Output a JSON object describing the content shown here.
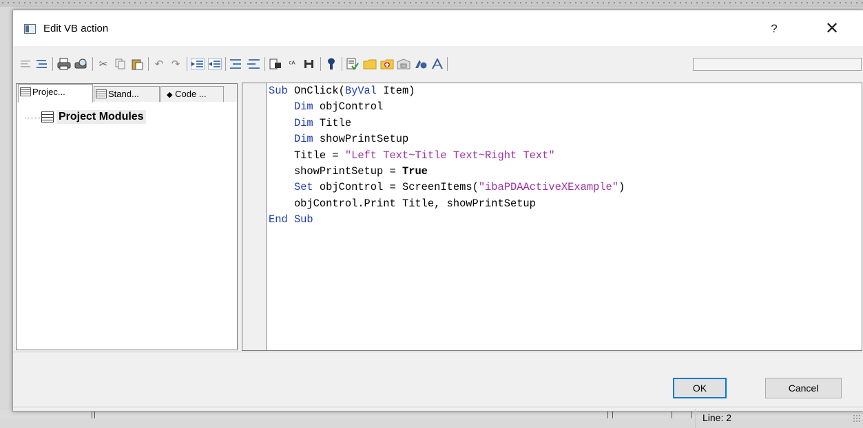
{
  "window": {
    "title": "Edit VB action",
    "help_label": "?",
    "close_label": "✕"
  },
  "toolbar": {
    "icons": [
      "align-left-icon",
      "align-lines-icon",
      "print-icon",
      "print-preview-icon",
      "cut-icon",
      "copy-icon",
      "paste-icon",
      "undo-icon",
      "redo-icon",
      "indent-icon",
      "outdent-icon",
      "comment-icon",
      "uncomment-icon",
      "find-icon",
      "replace-icon",
      "goto-icon",
      "breakpoint-icon",
      "syntax-check-icon",
      "folder-icon",
      "add-icon",
      "module-icon",
      "object-icon",
      "function-icon"
    ]
  },
  "left_panel": {
    "tabs": [
      {
        "label": "Projec..."
      },
      {
        "label": "Stand..."
      },
      {
        "label": "Code ..."
      }
    ],
    "tree": {
      "root_label": "Project Modules"
    }
  },
  "editor": {
    "lines": [
      "Sub OnClick(ByVal Item)",
      "    Dim objControl",
      "    Dim Title",
      "    Dim showPrintSetup",
      "    Title = \"Left Text~Title Text~Right Text\"",
      "    showPrintSetup = True",
      "    Set objControl = ScreenItems(\"ibaPDAActiveXExample\")",
      "    objControl.Print Title, showPrintSetup",
      "End Sub"
    ],
    "keyword_color": "#1e3cb4",
    "string_color": "#a030a8"
  },
  "buttons": {
    "ok": "OK",
    "cancel": "Cancel"
  },
  "status": {
    "line": "Line: 2"
  },
  "colors": {
    "accent": "#0078d7"
  }
}
